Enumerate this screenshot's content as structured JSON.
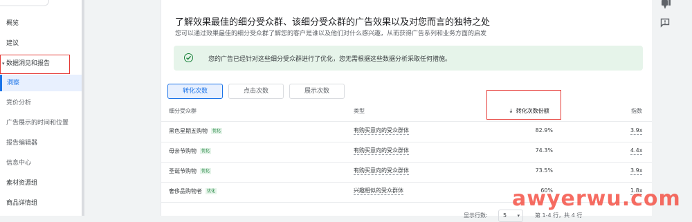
{
  "sidebar": {
    "items": [
      {
        "label": "概览"
      },
      {
        "label": "建议"
      },
      {
        "label": "数据洞见和报告",
        "expanded": true
      },
      {
        "label": "洞察",
        "active": true
      },
      {
        "label": "竞价分析"
      },
      {
        "label": "广告展示的时间和位置"
      },
      {
        "label": "报告编辑器"
      },
      {
        "label": "信息中心"
      },
      {
        "label": "素材资源组"
      },
      {
        "label": "商品详情组"
      }
    ]
  },
  "main": {
    "title": "了解效果最佳的细分受众群、该细分受众群的广告效果以及对您而言的独特之处",
    "subtitle": "您可以通过效果最佳的细分受众群了解您的客户是谁以及他们对什么感兴趣，从而获得广告系列和业务方面的启发",
    "banner": {
      "text": "您的广告已经针对这些细分受众群进行了优化，您无需根据这些数据分析采取任何措施。",
      "color": "#188038"
    },
    "tabs": [
      {
        "label": "转化次数",
        "active": true
      },
      {
        "label": "点击次数"
      },
      {
        "label": "展示次数"
      }
    ],
    "table": {
      "columns": [
        "细分受众群",
        "类型",
        "转化次数份额",
        "指数"
      ],
      "sort_column": "转化次数份额",
      "sort_direction": "down",
      "rows": [
        {
          "segment": "黑色星期五购物",
          "badge": "优化",
          "type": "有购买意向的受众群体",
          "share": "82.9%",
          "index": "3.9x"
        },
        {
          "segment": "母亲节购物",
          "badge": "优化",
          "type": "有购买意向的受众群体",
          "share": "74.3%",
          "index": "4.4x"
        },
        {
          "segment": "圣诞节购物",
          "badge": "优化",
          "type": "有购买意向的受众群体",
          "share": "73.5%",
          "index": "3.9x"
        },
        {
          "segment": "奢侈品购物者",
          "badge": "优化",
          "type": "兴趣相似的受众群体",
          "share": "60%",
          "index": "1.8x"
        }
      ]
    },
    "pagination": {
      "rows_label": "显示行数:",
      "rows_value": "5",
      "range_label": "第 1-4 行，共 4 行"
    }
  },
  "watermark": "awyerwu.com",
  "colors": {
    "accent": "#1a73e8",
    "success": "#188038",
    "highlight_box": "#e53935"
  }
}
